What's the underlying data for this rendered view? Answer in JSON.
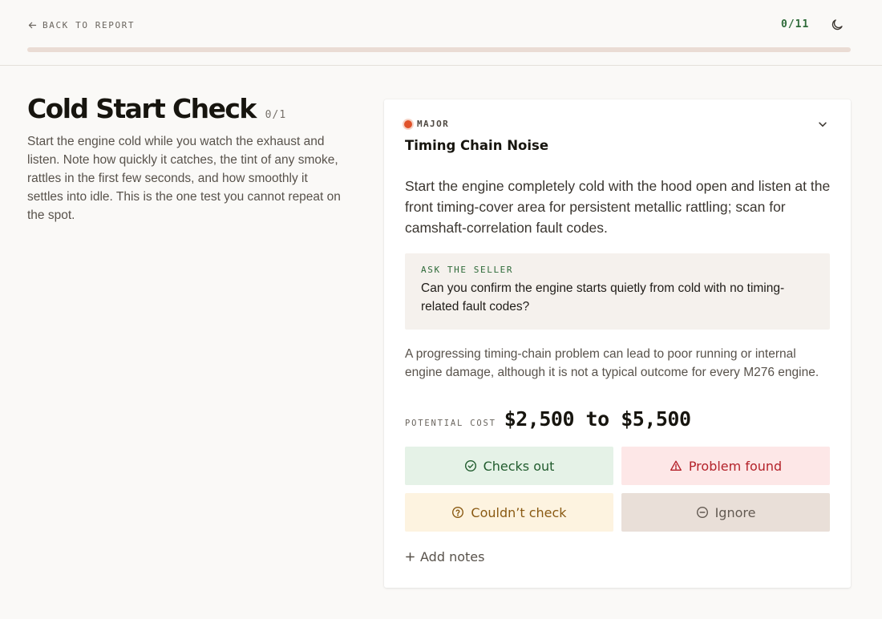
{
  "header": {
    "back_label": "BACK TO REPORT",
    "counter": "0/11",
    "progress_fraction": 0
  },
  "section": {
    "title": "Cold Start Check",
    "count": "0/1",
    "description": "Start the engine cold while you watch the exhaust and listen. Note how quickly it catches, the tint of any smoke, rattles in the first few seconds, and how smoothly it settles into idle. This is the one test you cannot repeat on the spot."
  },
  "issue": {
    "severity": "MAJOR",
    "severity_color": "#e0522a",
    "title": "Timing Chain Noise",
    "description": "Start the engine completely cold with the hood open and listen at the front timing-cover area for persistent metallic rattling; scan for camshaft-correlation fault codes.",
    "ask_label": "ASK THE SELLER",
    "ask_text": "Can you confirm the engine starts quietly from cold with no timing-related fault codes?",
    "consequence": "A progressing timing-chain problem can lead to poor running or internal engine damage, although it is not a typical outcome for every M276 engine.",
    "cost_label": "POTENTIAL COST",
    "cost_value": "$2,500 to $5,500"
  },
  "actions": {
    "ok_label": "Checks out",
    "problem_label": "Problem found",
    "cant_label": "Couldn’t check",
    "ignore_label": "Ignore",
    "add_notes_label": "Add notes"
  },
  "icons": {
    "back": "arrow-left-icon",
    "theme": "moon-icon",
    "collapse": "chevron-down-icon",
    "ok": "check-circle-icon",
    "problem": "warning-triangle-icon",
    "cant": "question-circle-icon",
    "ignore": "minus-circle-icon",
    "add": "plus-icon"
  },
  "colors": {
    "accent_green": "#2f6b3a",
    "problem_red": "#b4222a",
    "cant_amber": "#8a5a13"
  }
}
